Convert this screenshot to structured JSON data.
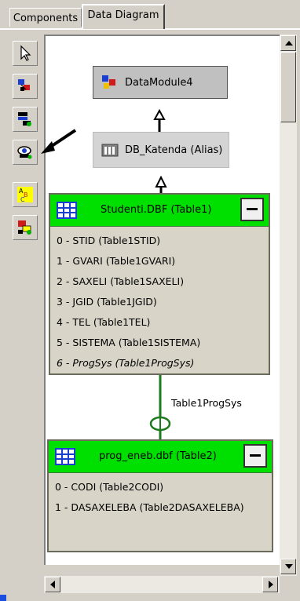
{
  "tabs": [
    {
      "label": "Components",
      "active": false
    },
    {
      "label": "Data Diagram",
      "active": true
    }
  ],
  "toolbar": {
    "tools": [
      {
        "name": "pointer-tool-button",
        "icon": "pointer-arrow-icon",
        "pressed": false
      },
      {
        "name": "property-link-tool-button",
        "icon": "property-link-icon",
        "pressed": false
      },
      {
        "name": "master-detail-tool-button",
        "icon": "master-detail-icon",
        "pressed": false
      },
      {
        "name": "lookup-tool-button",
        "icon": "lookup-eye-icon",
        "pressed": false
      },
      {
        "name": "comment-block-tool-button",
        "icon": "comment-abc-icon",
        "pressed": false
      },
      {
        "name": "comment-allusion-tool-button",
        "icon": "comment-allusion-icon",
        "pressed": false
      }
    ]
  },
  "diagram": {
    "datamodule": {
      "label": "DataModule4"
    },
    "database": {
      "label": "DB_Katenda (Alias)"
    },
    "table1": {
      "title": "Studenti.DBF (Table1)",
      "fields": [
        "0 - STID (Table1STID)",
        "1 - GVARI (Table1GVARI)",
        "2 - SAXELI (Table1SAXELI)",
        "3 - JGID (Table1JGID)",
        "4 - TEL (Table1TEL)",
        "5 - SISTEMA (Table1SISTEMA)",
        "6 - ProgSys (Table1ProgSys)"
      ]
    },
    "link": {
      "label": "Table1ProgSys"
    },
    "table2": {
      "title": "prog_eneb.dbf (Table2)",
      "fields": [
        "0 - CODI (Table2CODI)",
        "1 - DASAXELEBA (Table2DASAXELEBA)"
      ]
    }
  },
  "colors": {
    "table_header": "#00e000",
    "connector": "#1f7a1f",
    "annotation_arrow": "#000000"
  }
}
